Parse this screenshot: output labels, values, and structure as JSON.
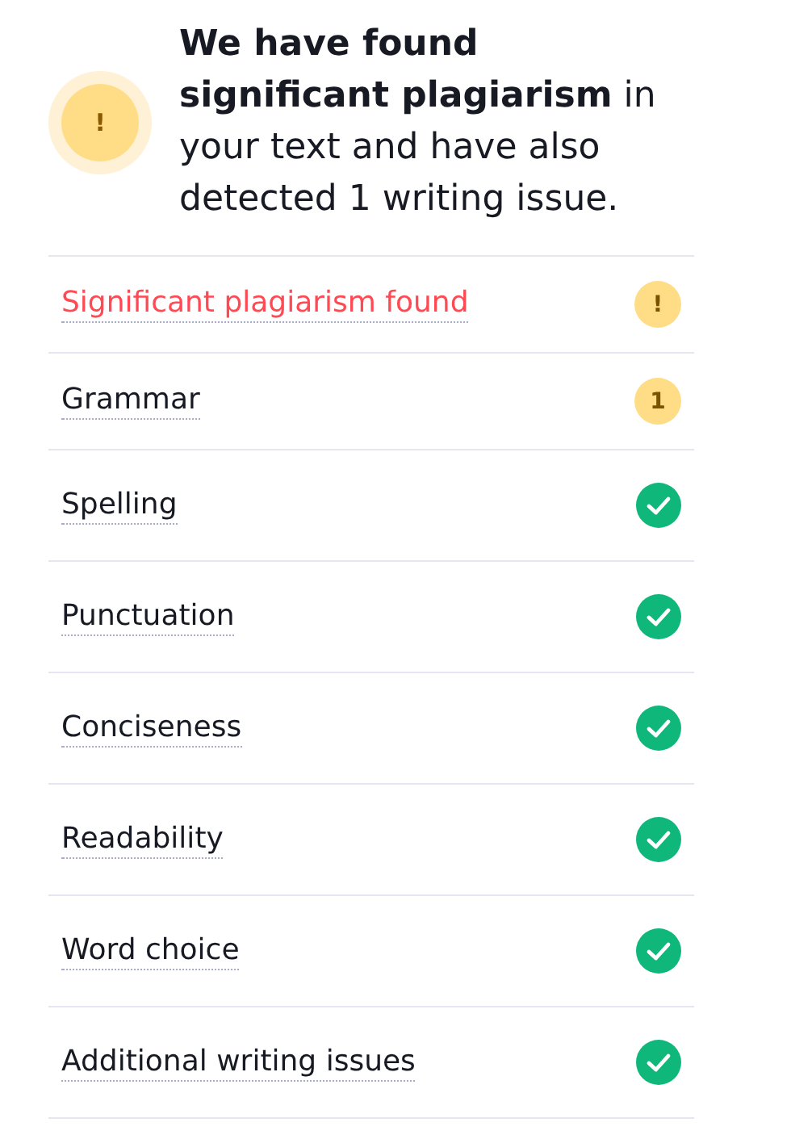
{
  "summary": {
    "icon": "!",
    "text": "**We have found significant plagiarism** in your text and have also detected 1 writing issue."
  },
  "checks": [
    {
      "label": "Significant plagiarism found",
      "kind": "warning",
      "alert": true,
      "badge": "!"
    },
    {
      "label": "Grammar",
      "kind": "count",
      "alert": false,
      "badge": "1"
    },
    {
      "label": "Spelling",
      "kind": "ok",
      "alert": false
    },
    {
      "label": "Punctuation",
      "kind": "ok",
      "alert": false
    },
    {
      "label": "Conciseness",
      "kind": "ok",
      "alert": false
    },
    {
      "label": "Readability",
      "kind": "ok",
      "alert": false
    },
    {
      "label": "Word choice",
      "kind": "ok",
      "alert": false
    },
    {
      "label": "Additional writing issues",
      "kind": "ok",
      "alert": false
    }
  ]
}
